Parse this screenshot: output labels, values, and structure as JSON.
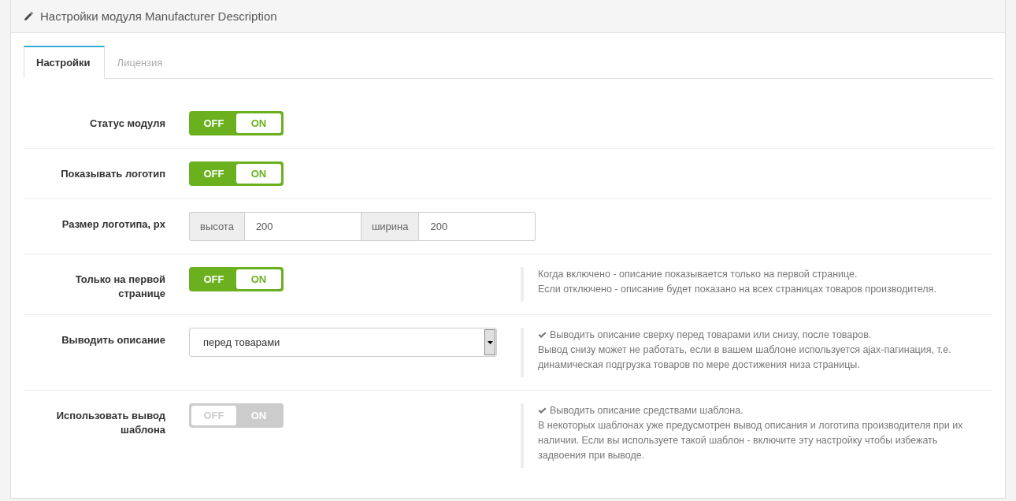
{
  "panel": {
    "title": "Настройки модуля Manufacturer Description"
  },
  "tabs": [
    {
      "label": "Настройки",
      "selected": true
    },
    {
      "label": "Лицензия",
      "selected": false
    }
  ],
  "rows": [
    {
      "kind": "toggle",
      "label": "Статус модуля",
      "on": true,
      "off_label": "OFF",
      "on_label": "ON"
    },
    {
      "kind": "toggle",
      "label": "Показывать логотип",
      "on": true,
      "off_label": "OFF",
      "on_label": "ON"
    },
    {
      "kind": "size",
      "label": "Размер логотипа, px",
      "fields": [
        {
          "addon": "высота",
          "value": "200"
        },
        {
          "addon": "ширина",
          "value": "200"
        }
      ]
    },
    {
      "kind": "toggle",
      "label": "Только на первой странице",
      "on": true,
      "off_label": "OFF",
      "on_label": "ON",
      "help": {
        "check": false,
        "paragraphs": [
          "Когда включено - описание показывается только на первой странице.",
          "Если отключено - описание будет показано на всех страницах товаров производителя."
        ]
      }
    },
    {
      "kind": "select",
      "label": "Выводить описание",
      "value": "перед товарами",
      "help": {
        "check": true,
        "paragraphs": [
          "Выводить описание сверху перед товарами или снизу, после товаров.",
          "Вывод снизу может не работать, если в вашем шаблоне используется ajax-пагинация, т.е. динамическая подгрузка товаров по мере достижения низа страницы."
        ]
      }
    },
    {
      "kind": "toggle",
      "label": "Использовать вывод шаблона",
      "on": false,
      "off_label": "OFF",
      "on_label": "ON",
      "help": {
        "check": true,
        "paragraphs": [
          "Выводить описание средствами шаблона.",
          "В некоторых шаблонах уже предусмотрен вывод описания и логотипа производителя при их наличии. Если вы используете такой шаблон - включите эту настройку чтобы избежать задвоения при выводе."
        ]
      }
    }
  ]
}
